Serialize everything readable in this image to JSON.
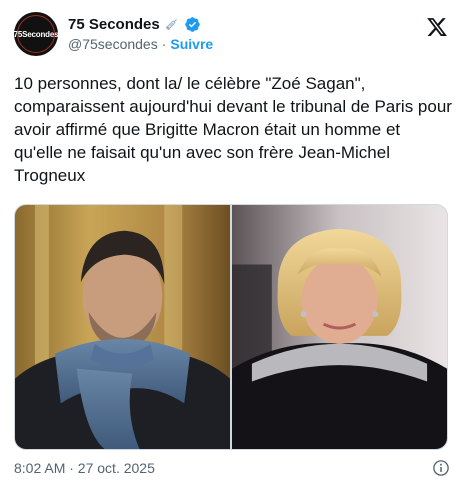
{
  "author": {
    "avatar_text": "75Secondes",
    "display_name": "75 Secondes",
    "handle": "@75secondes",
    "separator": "·",
    "follow_label": "Suivre",
    "name_icons": [
      "syringe-icon",
      "verified-icon"
    ]
  },
  "tweet": {
    "text": "10 personnes, dont la/ le célèbre \"Zoé Sagan\", comparaissent aujourd'hui devant le tribunal de Paris pour avoir affirmé que Brigitte Macron était un homme et qu'elle ne faisait qu'un avec son frère Jean-Michel Trogneux"
  },
  "media": {
    "photos": [
      "photo-man-blue-scarf",
      "photo-woman-blonde"
    ]
  },
  "footer": {
    "timestamp": "8:02 AM · 27 oct. 2025",
    "icon": "info-icon"
  },
  "colors": {
    "link": "#1d9bf0",
    "muted": "#536471",
    "text": "#0f1419",
    "verified": "#1d9bf0"
  }
}
